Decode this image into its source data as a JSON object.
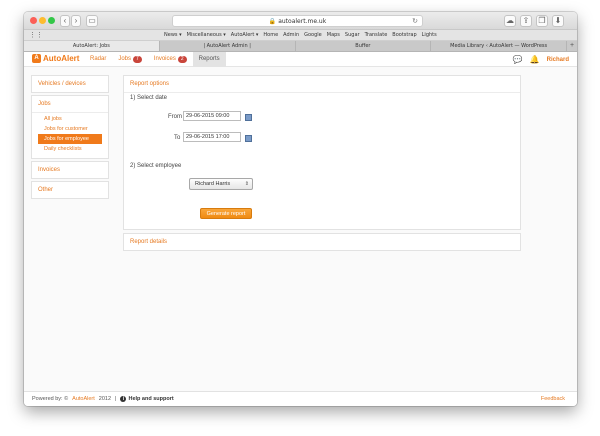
{
  "browser": {
    "url": "autoalert.me.uk",
    "bookmarks": [
      "News ▾",
      "Miscellaneous ▾",
      "AutoAlert ▾",
      "Home",
      "Admin",
      "Google",
      "Maps",
      "Sugar",
      "Translate",
      "Bootstrap",
      "Lights"
    ],
    "tabs": [
      {
        "label": "AutoAlert: Jobs",
        "active": true
      },
      {
        "label": "| AutoAlert Admin |",
        "active": false
      },
      {
        "label": "Buffer",
        "active": false
      },
      {
        "label": "Media Library ‹ AutoAlert — WordPress",
        "active": false
      }
    ],
    "traffic_colors": [
      "#fc5f57",
      "#fdbc2e",
      "#33c748"
    ]
  },
  "app": {
    "logo_text": "AutoAlert",
    "nav": [
      {
        "label": "Radar",
        "badge": null
      },
      {
        "label": "Jobs",
        "badge": "7"
      },
      {
        "label": "Invoices",
        "badge": "2"
      },
      {
        "label": "Reports",
        "badge": null
      }
    ],
    "user": "Richard",
    "accent": "#f07a1a"
  },
  "sidebar": {
    "vehicles": "Vehicles / devices",
    "jobs": "Jobs",
    "jobs_items": [
      "All jobs",
      "Jobs for customer",
      "Jobs for employee",
      "Daily checklists"
    ],
    "jobs_selected": "Jobs for employee",
    "invoices": "Invoices",
    "other": "Other"
  },
  "report": {
    "options_title": "Report options",
    "step1": "1) Select date",
    "from_label": "From",
    "from_value": "29-06-2015 09:00",
    "to_label": "To",
    "to_value": "29-06-2015 17:00",
    "step2": "2) Select employee",
    "employee": "Richard Harris",
    "generate": "Generate report",
    "details_title": "Report details"
  },
  "footer": {
    "powered": "Powered by: ©",
    "brand": "AutoAlert",
    "year": "2012",
    "sep": "|",
    "help": "Help and support",
    "feedback": "Feedback"
  }
}
